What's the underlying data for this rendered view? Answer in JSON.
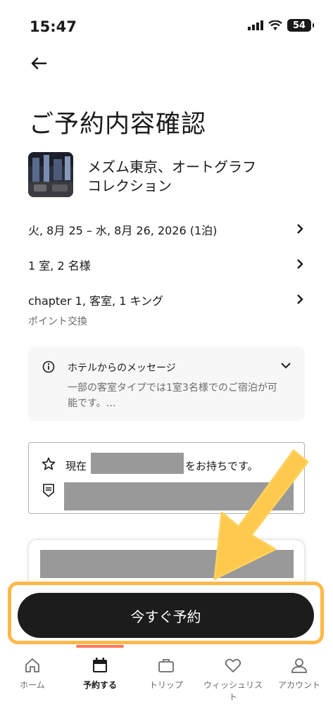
{
  "status": {
    "time": "15:47",
    "battery": "54"
  },
  "page": {
    "title": "ご予約内容確認"
  },
  "hotel": {
    "name": "メズム東京、オートグラフ コレクション"
  },
  "details": [
    {
      "label": "火, 8月 25 – 水, 8月 26, 2026 (1泊)",
      "sub": ""
    },
    {
      "label": "1 室, 2 名様",
      "sub": ""
    },
    {
      "label": "chapter 1, 客室, 1 キング",
      "sub": "ポイント交換"
    }
  ],
  "message": {
    "title": "ホテルからのメッセージ",
    "body": "一部の客室タイプでは1室3名様でのご宿泊が可能です。…"
  },
  "points": {
    "prefix": "現在",
    "suffix": "をお持ちです。"
  },
  "cta": {
    "label": "今すぐ予約"
  },
  "nav": {
    "items": [
      {
        "label": "ホーム",
        "icon": "home-icon"
      },
      {
        "label": "予約する",
        "icon": "calendar-icon"
      },
      {
        "label": "トリップ",
        "icon": "briefcase-icon"
      },
      {
        "label": "ウィッシュリスト",
        "icon": "heart-icon"
      },
      {
        "label": "アカウント",
        "icon": "person-icon"
      }
    ],
    "active_index": 1
  },
  "colors": {
    "highlight": "#ffb84a",
    "arrow": "#ffc94d",
    "cta_bg": "#1c1c1c",
    "redaction": "#999999",
    "nav_indicator": "#ff7a59"
  }
}
